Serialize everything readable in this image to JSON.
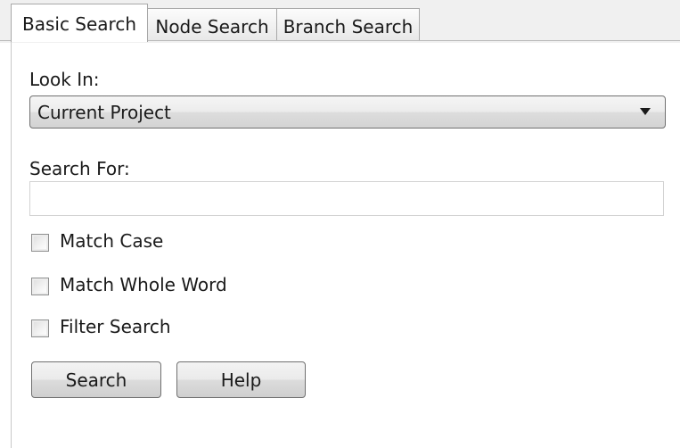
{
  "tabs": {
    "basic": "Basic Search",
    "node": "Node Search",
    "branch": "Branch Search"
  },
  "look_in": {
    "label": "Look In:",
    "selected": "Current Project"
  },
  "search_for": {
    "label": "Search For:",
    "value": "",
    "placeholder": ""
  },
  "options": {
    "match_case": "Match Case",
    "match_whole_word": "Match Whole Word",
    "filter_search": "Filter Search"
  },
  "buttons": {
    "search": "Search",
    "help": "Help"
  },
  "icons": {
    "dropdown": "chevron-down-icon"
  }
}
